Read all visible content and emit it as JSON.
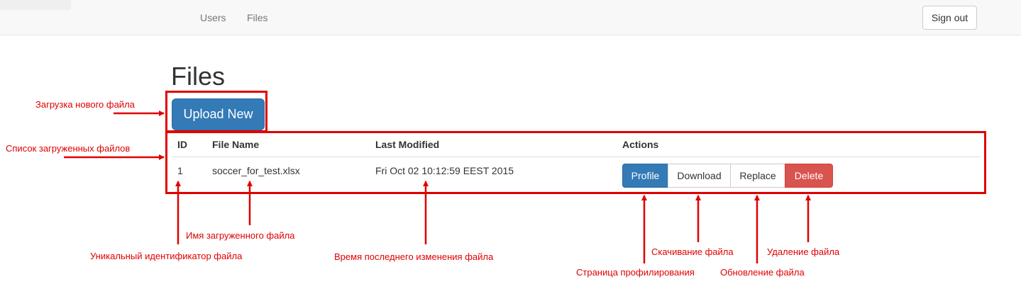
{
  "navbar": {
    "links": [
      "Users",
      "Files"
    ],
    "signout_label": "Sign out"
  },
  "page": {
    "title": "Files",
    "upload_label": "Upload New"
  },
  "table": {
    "columns": [
      "ID",
      "File Name",
      "Last Modified",
      "Actions"
    ],
    "rows": [
      {
        "id": "1",
        "file_name": "soccer_for_test.xlsx",
        "last_modified": "Fri Oct 02 10:12:59 EEST 2015",
        "actions": [
          "Profile",
          "Download",
          "Replace",
          "Delete"
        ]
      }
    ]
  },
  "annotations": {
    "upload": "Загрузка нового файла",
    "list": "Список загруженных файлов",
    "file_name": "Имя загруженного файла",
    "id": "Уникальный идентификатор файла",
    "modified": "Время последнего изменения файла",
    "download": "Скачивание файла",
    "delete": "Удаление файла",
    "profile": "Страница профилирования",
    "replace": "Обновление файла"
  },
  "colors": {
    "primary": "#337ab7",
    "danger": "#d9534f",
    "annotation": "#e00000"
  }
}
